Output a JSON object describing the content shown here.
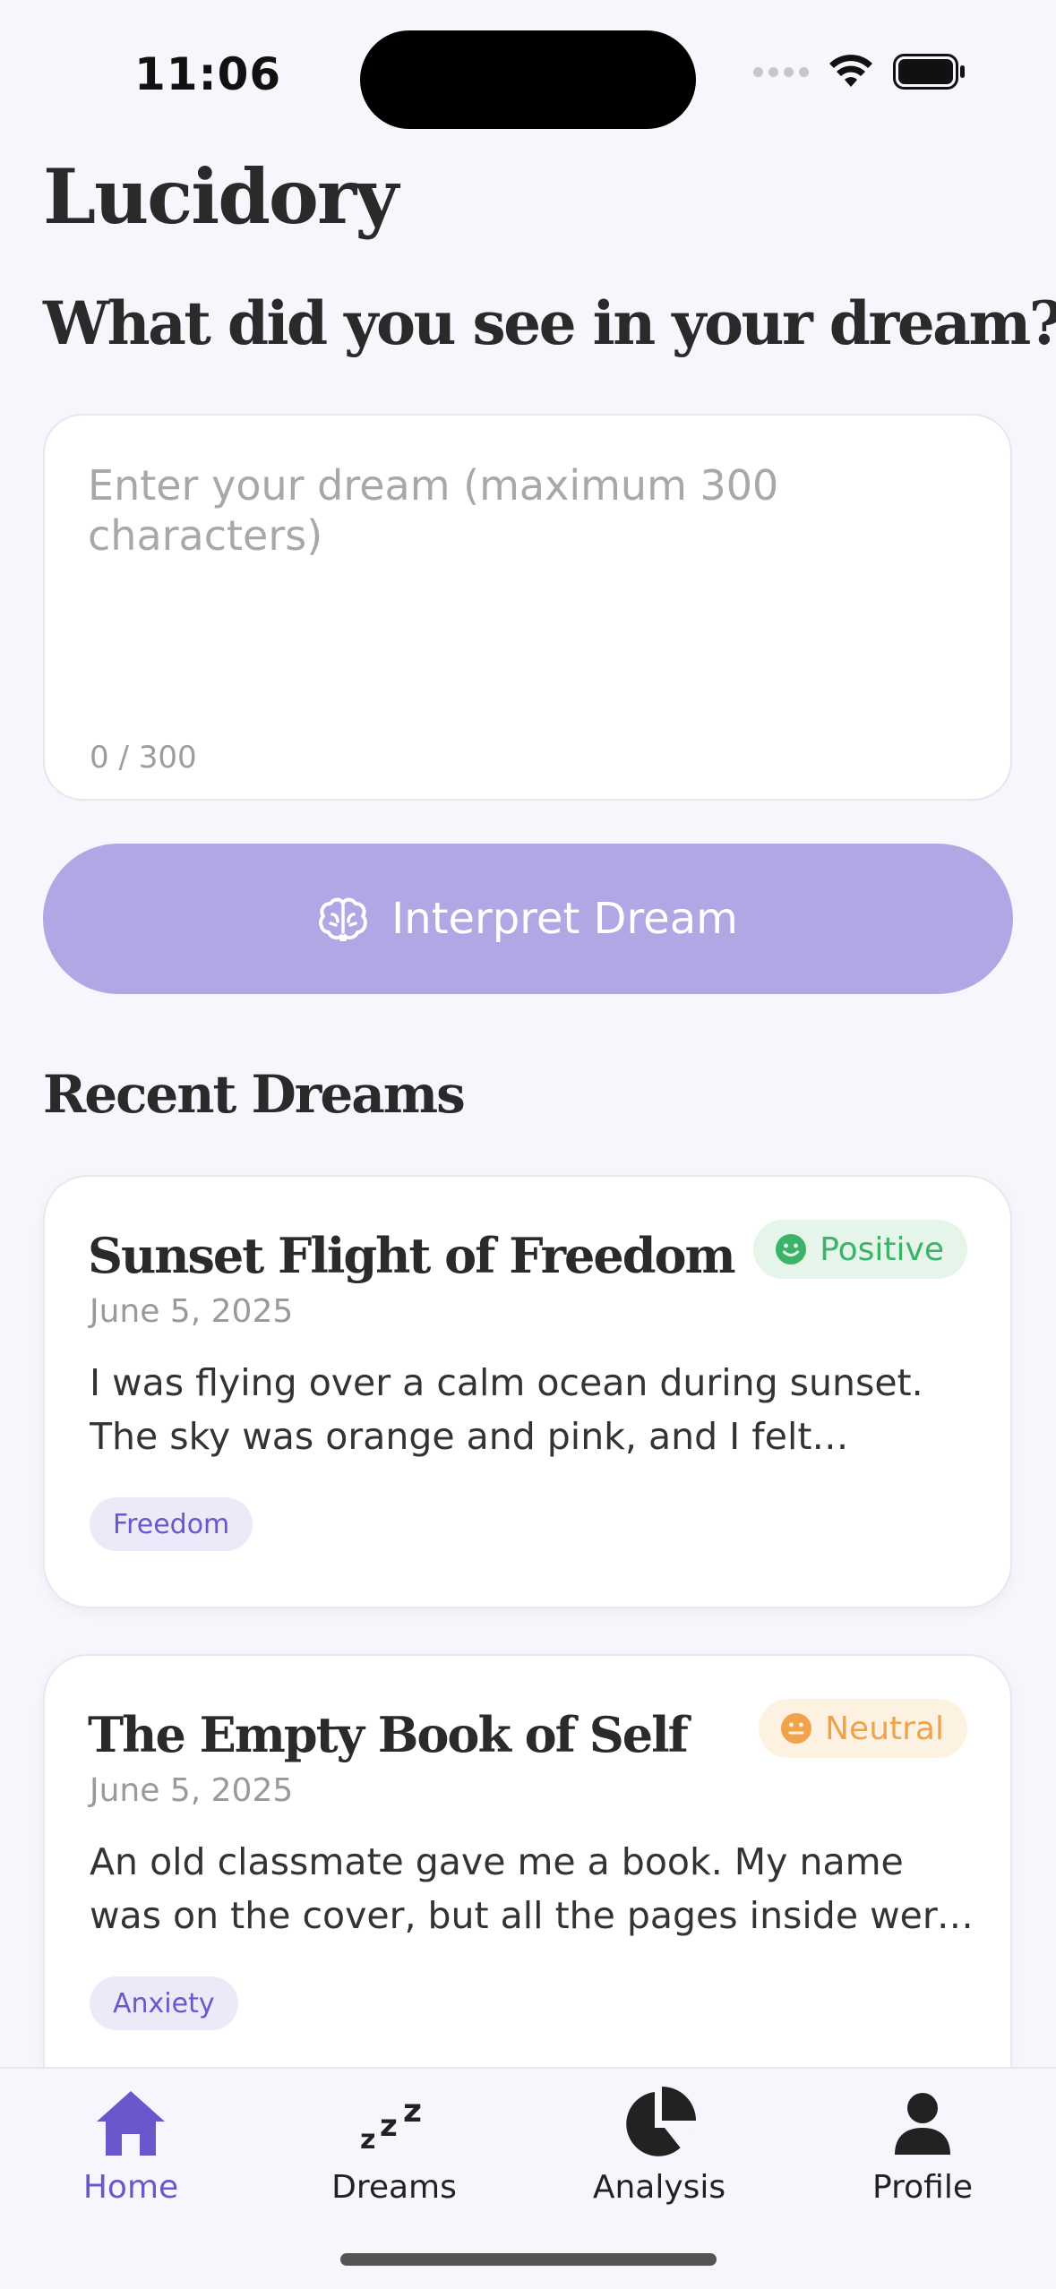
{
  "status_bar": {
    "time": "11:06"
  },
  "app": {
    "title": "Lucidory"
  },
  "prompt": {
    "heading": "What did you see in your dream?",
    "placeholder": "Enter your dream (maximum 300 characters)",
    "value": "",
    "char_count": "0 / 300"
  },
  "interpret_button": {
    "label": "Interpret Dream",
    "icon": "brain-icon"
  },
  "recent": {
    "heading": "Recent Dreams",
    "items": [
      {
        "title": "Sunset Flight of Freedom",
        "date": "June 5, 2025",
        "text": "I was flying over a calm ocean during sunset. The sky was orange and pink, and I felt completely free…",
        "mood": "Positive",
        "mood_color": "#3db36a",
        "tag": "Freedom"
      },
      {
        "title": "The Empty Book of Self",
        "date": "June 5, 2025",
        "text": "An old classmate gave me a book. My name was on the cover, but all the pages inside were blank.",
        "mood": "Neutral",
        "mood_color": "#f0a34a",
        "tag": "Anxiety"
      }
    ]
  },
  "tabs": [
    {
      "label": "Home",
      "icon": "home-icon",
      "active": true
    },
    {
      "label": "Dreams",
      "icon": "sleep-zzz-icon",
      "active": false
    },
    {
      "label": "Analysis",
      "icon": "pie-chart-icon",
      "active": false
    },
    {
      "label": "Profile",
      "icon": "person-icon",
      "active": false
    }
  ],
  "colors": {
    "accent": "#6a57cc",
    "button": "#b0a8e4",
    "background": "#f6f7fc"
  }
}
